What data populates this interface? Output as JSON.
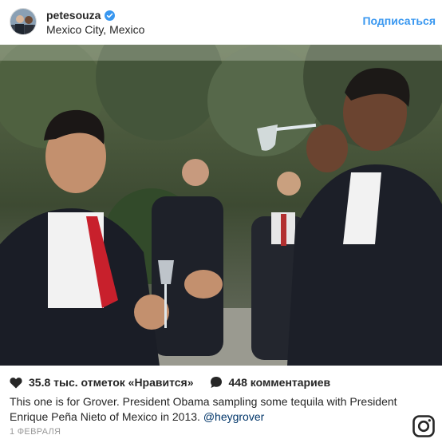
{
  "header": {
    "username": "petesouza",
    "location": "Mexico City, Mexico",
    "follow_label": "Подписаться",
    "verified_color": "#3897f0"
  },
  "actions": {
    "likes_label": "35.8 тыс. отметок «Нравится»",
    "comments_label": "448 комментариев"
  },
  "caption": {
    "text": "This one is for Grover. President Obama sampling some tequila with President Enrique Peña Nieto of Mexico in 2013.",
    "mention": "@heygrover"
  },
  "date": "1 ФЕВРАЛЯ",
  "icons": {
    "heart": "heart-icon",
    "comment": "comment-bubble-icon",
    "logo": "instagram-logo-icon",
    "verified": "verified-badge-icon"
  },
  "colors": {
    "link": "#3897f0",
    "mention": "#003569",
    "muted": "#999999"
  }
}
